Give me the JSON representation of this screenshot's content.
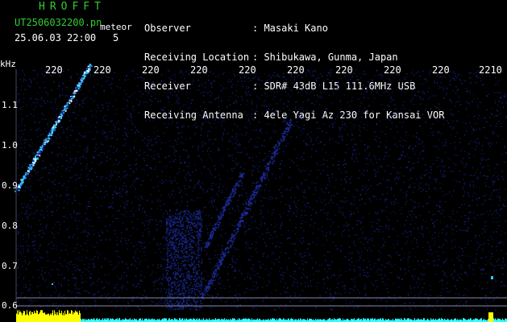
{
  "header": {
    "app_title": "HROFFT",
    "filename": "UT2506032200.pn",
    "meteor_label": "meteor",
    "datetime": "25.06.03 22:00",
    "count": "5"
  },
  "info": {
    "labels": [
      "Observer",
      "Receiving Location",
      "Receiver",
      "Receiving Antenna"
    ],
    "values": [
      ": Masaki Kano",
      ": Shibukawa, Gunma, Japan",
      ": SDR# 43dB L15 111.6MHz USB",
      ": 4ele Yagi Az 230 for Kansai VOR"
    ]
  },
  "chart_data": {
    "type": "heatmap",
    "ylabel": "kHz",
    "x_ticks": [
      "220",
      "220",
      "220",
      "220",
      "220",
      "220",
      "220",
      "220",
      "220",
      "2210"
    ],
    "y_ticks": [
      "1.1",
      "1.0",
      "0.9",
      "0.8",
      "0.7",
      "0.6"
    ],
    "colors": {
      "background": "#000000",
      "noise": "#1a2a9a",
      "signal": "#33ccff",
      "strong": "#ffffff",
      "text": "#ffffff",
      "title": "#33cc33",
      "meter_left": "#ffff00",
      "meter_right": "#33ffff"
    }
  }
}
